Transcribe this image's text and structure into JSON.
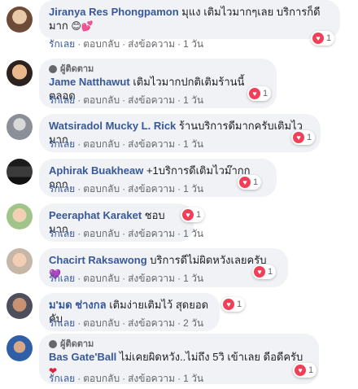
{
  "colors": {
    "name": "#385898",
    "bubble": "#f0f2f5",
    "meta": "#65676b",
    "heart": "#f33e58"
  },
  "comments": [
    {
      "name": "Jiranya Res Phongpamon",
      "text": "มุแง เติมไวมากๆเลย บริการก็ดี",
      "text2": "มาก",
      "emoji": "😊💕",
      "follower": "",
      "like": "รักเลย",
      "reply": "ตอบกลับ",
      "send": "ส่งข้อความ",
      "time": "1 วัน",
      "reactions": "1",
      "react_icon": "heart-icon"
    },
    {
      "name": "Jame Natthawut",
      "text": "เติมไวมากปกติเติมร้านนี้ตลอด",
      "follower": "ผู้ติดตาม",
      "like": "รักเลย",
      "reply": "ตอบกลับ",
      "send": "ส่งข้อความ",
      "time": "1 วัน",
      "reactions": "1",
      "react_icon": "heart-icon"
    },
    {
      "name": "Watsiradol Mucky L. Rick",
      "text": "ร้านบริการดีมากครับเติมไวมาก",
      "follower": "",
      "like": "รักเลย",
      "reply": "ตอบกลับ",
      "send": "ส่งข้อความ",
      "time": "1 วัน",
      "reactions": "1",
      "react_icon": "heart-icon"
    },
    {
      "name": "Aphirak Buakheaw",
      "text": "+1บริการดีเติมไวม๊ากกกกก",
      "follower": "",
      "like": "รักเลย",
      "reply": "ตอบกลับ",
      "send": "ส่งข้อความ",
      "time": "1 วัน",
      "reactions": "1",
      "react_icon": "heart-icon"
    },
    {
      "name": "Peeraphat Karaket",
      "text": "ชอบมาก",
      "follower": "",
      "like": "รักเลย",
      "reply": "ตอบกลับ",
      "send": "ส่งข้อความ",
      "time": "1 วัน",
      "reactions": "1",
      "react_icon": "heart-icon"
    },
    {
      "name": "Chacirt Raksawong",
      "text": "บริการดีไม่ผิดหวังเลยครับ",
      "emoji": "💜",
      "follower": "",
      "like": "รักเลย",
      "reply": "ตอบกลับ",
      "send": "ส่งข้อความ",
      "time": "1 วัน",
      "reactions": "1",
      "react_icon": "heart-icon"
    },
    {
      "name": "ม'มด ช่างกล",
      "text": "เติมง่ายเติมไว้ สุดยอดคับ",
      "follower": "",
      "like": "รักเลย",
      "reply": "ตอบกลับ",
      "send": "ส่งข้อความ",
      "time": "2 วัน",
      "reactions": "1",
      "react_icon": "heart-icon"
    },
    {
      "name": "Bas Gate'Ball",
      "text": "ไม่เคยผิดหวัง..ไม่ถึง 5วิ เข้าเลย ดีอดีครับ",
      "emoji": "❤",
      "follower": "ผู้ติดตาม",
      "like": "รักเลย",
      "reply": "ตอบกลับ",
      "send": "ส่งข้อความ",
      "time": "1 วัน",
      "reactions": "1",
      "react_icon": "heart-icon"
    }
  ]
}
